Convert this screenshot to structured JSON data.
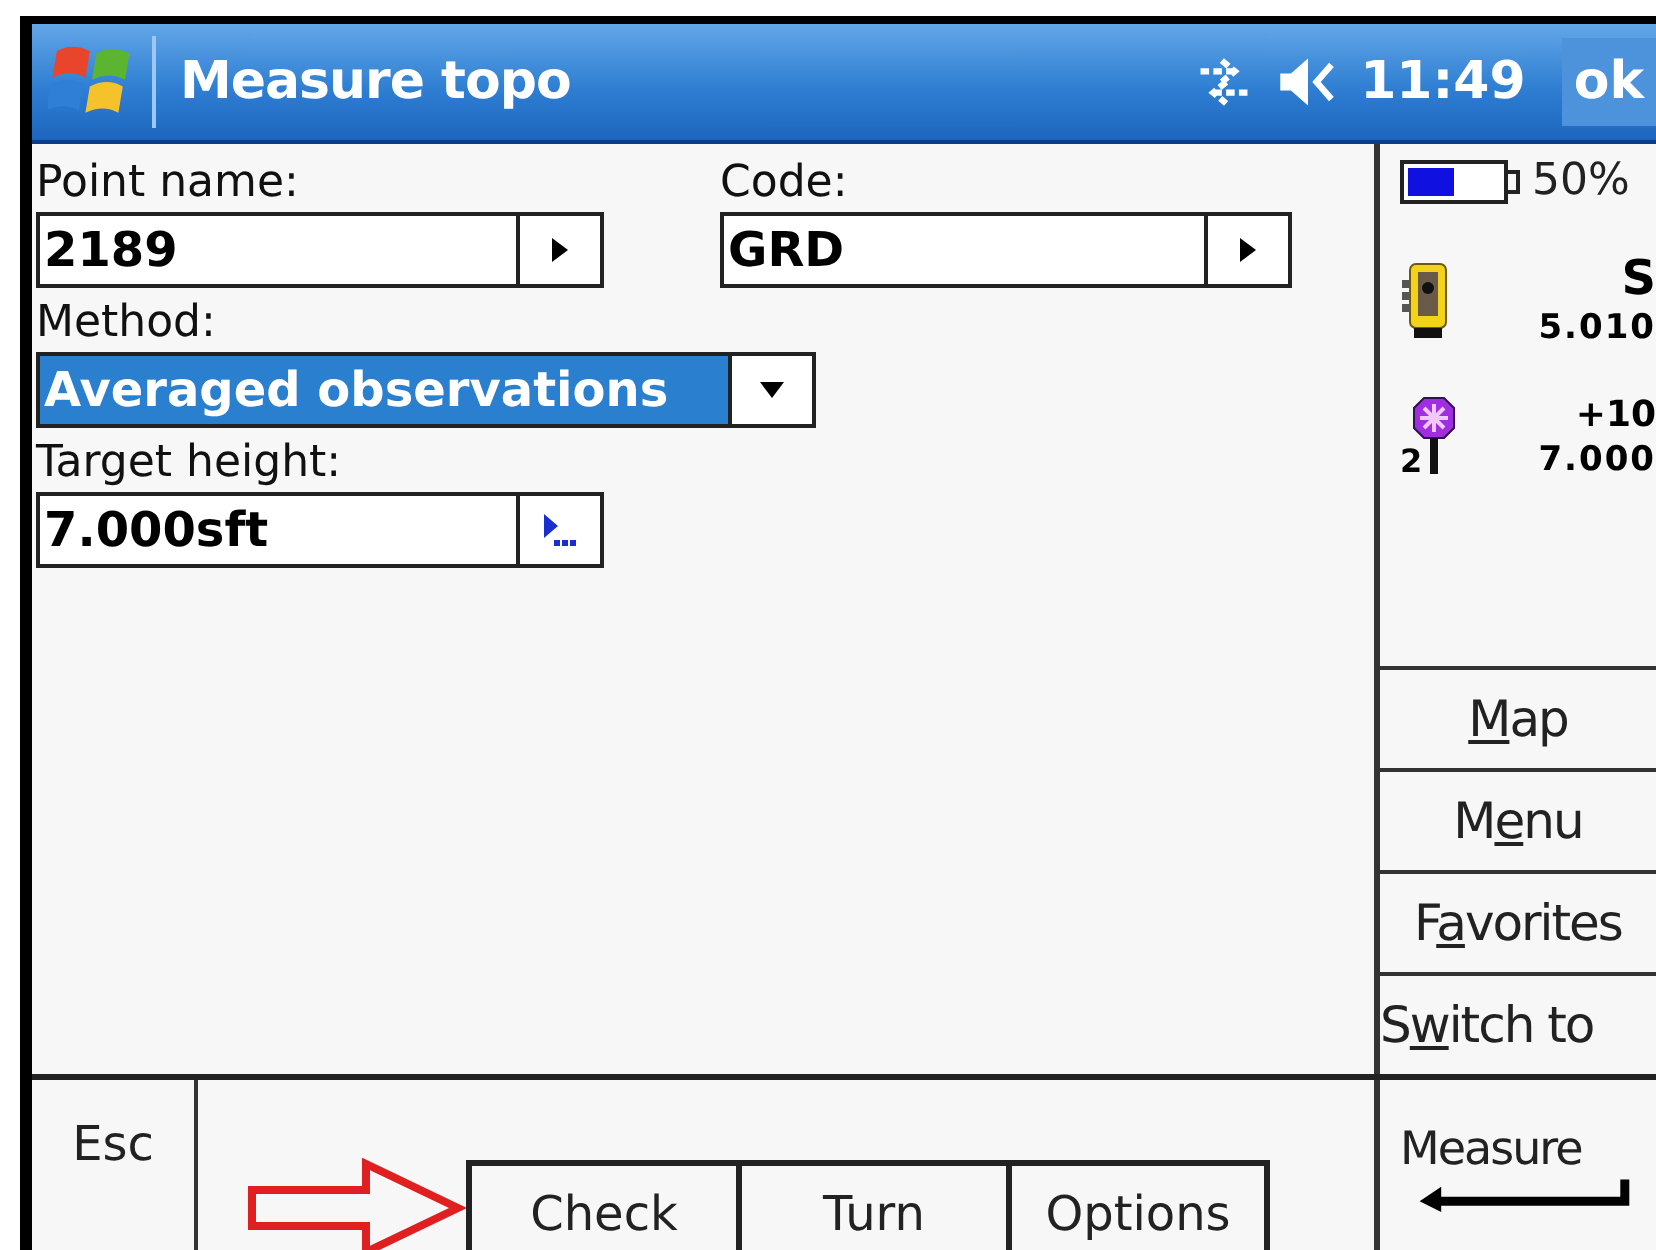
{
  "title_bar": {
    "title": "Measure topo",
    "time": "11:49",
    "ok": "ok"
  },
  "fields": [
    {
      "kind": "picker",
      "label": "Point name:",
      "value": "2189"
    },
    {
      "kind": "picker",
      "label": "Code:",
      "value": "GRD"
    },
    {
      "kind": "dropdown",
      "label": "Method:",
      "value": "Averaged observations",
      "selected": true
    },
    {
      "kind": "popup",
      "label": "Target height:",
      "value": "7.000sft"
    }
  ],
  "status": {
    "battery": {
      "level": 0.5,
      "reading": "50%"
    },
    "instrument": {
      "line_1": "S",
      "line_2": "5.010"
    },
    "target": {
      "number": "2",
      "line_1": "+10",
      "line_2": "7.000"
    }
  },
  "side_buttons": [
    {
      "hotkey": "M",
      "after": "ap"
    },
    {
      "before": "M",
      "hotkey": "e",
      "after": "nu"
    },
    {
      "before": "F",
      "hotkey": "a",
      "after": "vorites"
    },
    {
      "before": "S",
      "hotkey": "w",
      "after": "itch to"
    }
  ],
  "bottom": {
    "esc": "Esc",
    "tabs": [
      "Check",
      "Turn",
      "Options"
    ],
    "measure": "Measure"
  }
}
